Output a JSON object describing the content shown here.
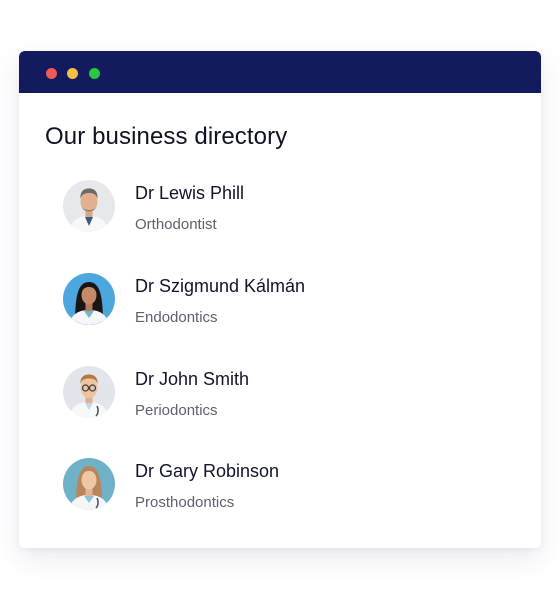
{
  "window": {
    "controls": [
      {
        "icon": "close-dot",
        "color": "#ee5b5a"
      },
      {
        "icon": "minimize-dot",
        "color": "#f4bf44"
      },
      {
        "icon": "maximize-dot",
        "color": "#29c840"
      }
    ],
    "titlebar_color": "#131b5e"
  },
  "directory": {
    "title": "Our business directory",
    "entries": [
      {
        "name": "Dr Lewis Phill",
        "specialty": "Orthodontist",
        "avatar_icon": "doctor-male-avatar"
      },
      {
        "name": "Dr Szigmund Kálmán",
        "specialty": "Endodontics",
        "avatar_icon": "doctor-female-avatar"
      },
      {
        "name": "Dr John Smith",
        "specialty": "Periodontics",
        "avatar_icon": "doctor-male-glasses-avatar"
      },
      {
        "name": "Dr Gary Robinson",
        "specialty": "Prosthodontics",
        "avatar_icon": "doctor-female-avatar"
      }
    ]
  }
}
